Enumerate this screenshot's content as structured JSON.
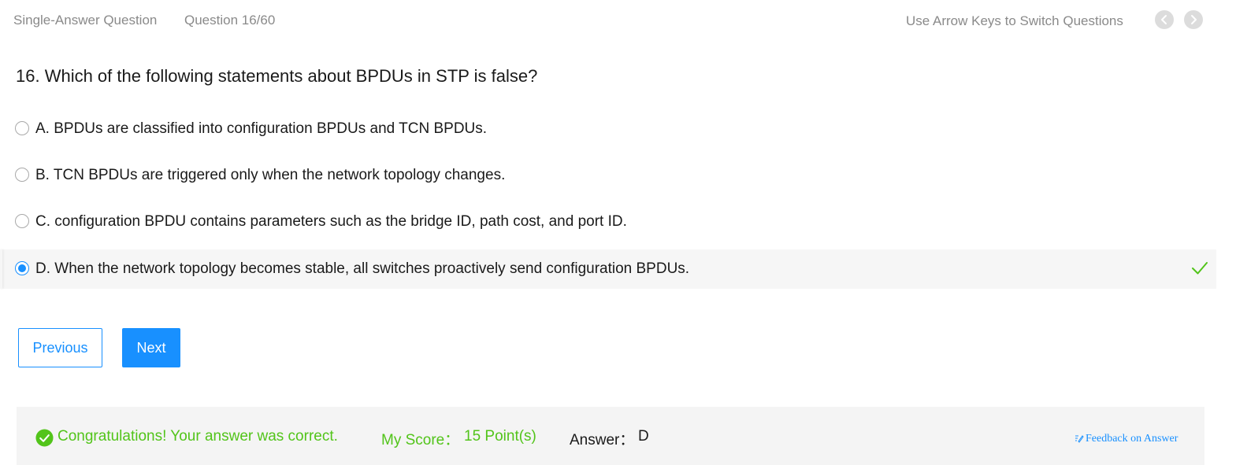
{
  "header": {
    "question_type": "Single-Answer Question",
    "question_count": "Question 16/60",
    "hint": "Use Arrow Keys to Switch Questions",
    "prev_icon": "chevron-left-icon",
    "next_icon": "chevron-right-icon"
  },
  "question": {
    "text": "16. Which of the following statements about BPDUs in STP is false?"
  },
  "options": [
    {
      "text": "A. BPDUs are classified into configuration BPDUs and TCN BPDUs.",
      "selected": false
    },
    {
      "text": "B. TCN BPDUs are triggered only when the network topology changes.",
      "selected": false
    },
    {
      "text": "C. configuration BPDU contains parameters such as the bridge ID, path cost, and port ID.",
      "selected": false
    },
    {
      "text": "D. When the network topology becomes stable, all switches proactively send configuration BPDUs.",
      "selected": true
    }
  ],
  "buttons": {
    "previous": "Previous",
    "next": "Next"
  },
  "result": {
    "message": "Congratulations! Your answer was correct.",
    "score_label": "My Score：",
    "score_value": "15 Point(s)",
    "answer_label": "Answer：",
    "answer_value": "D",
    "feedback": "Feedback on Answer"
  },
  "colors": {
    "accent": "#1890ff",
    "success": "#52c41a",
    "muted": "#8a8a8a"
  }
}
